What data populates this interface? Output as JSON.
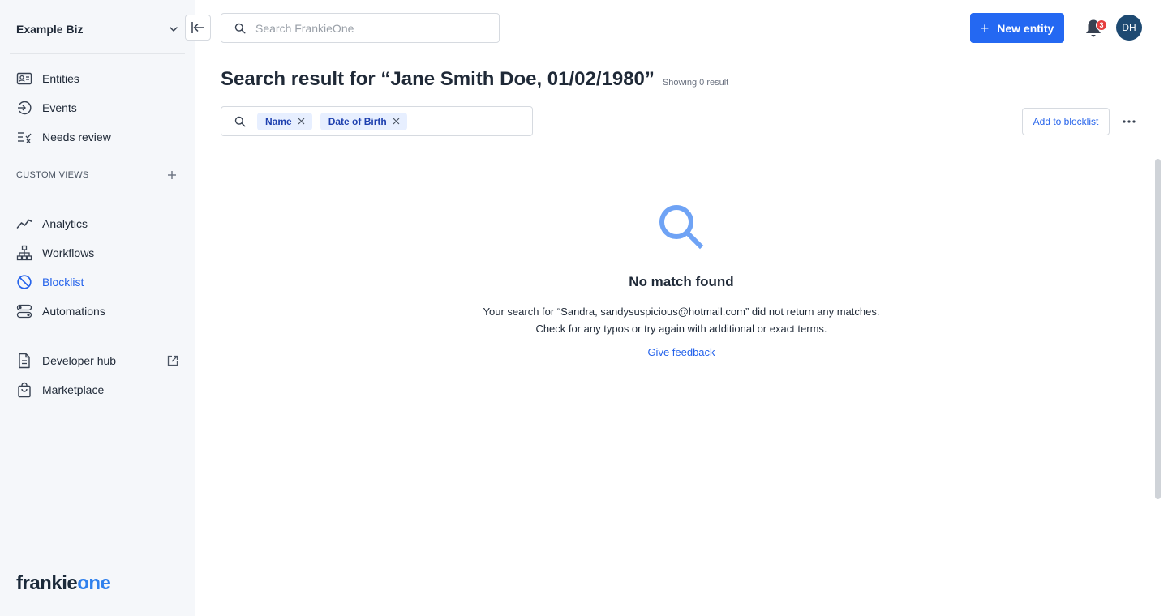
{
  "sidebar": {
    "org_name": "Example Biz",
    "nav_primary": [
      {
        "label": "Entities",
        "icon": "id-card-icon"
      },
      {
        "label": "Events",
        "icon": "events-icon"
      },
      {
        "label": "Needs review",
        "icon": "needs-review-icon"
      }
    ],
    "custom_views_title": "CUSTOM VIEWS",
    "nav_secondary": [
      {
        "label": "Analytics",
        "icon": "analytics-icon"
      },
      {
        "label": "Workflows",
        "icon": "workflows-icon"
      },
      {
        "label": "Blocklist",
        "icon": "blocklist-icon",
        "active": true
      },
      {
        "label": "Automations",
        "icon": "automations-icon"
      }
    ],
    "nav_tertiary": [
      {
        "label": "Developer hub",
        "icon": "document-icon",
        "external": true
      },
      {
        "label": "Marketplace",
        "icon": "shopping-bag-icon"
      }
    ],
    "brand_part1": "frankie",
    "brand_part2": "one"
  },
  "header": {
    "search_placeholder": "Search FrankieOne",
    "new_entity_label": "New entity",
    "notification_count": "3",
    "avatar_initials": "DH"
  },
  "main": {
    "title": "Search result for “Jane Smith Doe, 01/02/1980”",
    "result_count": "Showing 0 result",
    "filters": [
      "Name",
      "Date of Birth"
    ],
    "add_blocklist_label": "Add to blocklist",
    "empty_title": "No match found",
    "empty_line1": "Your search for “Sandra, sandysuspicious@hotmail.com” did not return any matches.",
    "empty_line2": "Check for any typos or try again with additional or exact terms.",
    "feedback_link": "Give feedback"
  },
  "colors": {
    "accent": "#2468f2",
    "sidebar_bg": "#f5f7fa",
    "chip_bg": "#e7efff",
    "badge": "#e53e3e",
    "avatar_bg": "#1e4a72",
    "empty_icon": "#6fa3f5"
  }
}
